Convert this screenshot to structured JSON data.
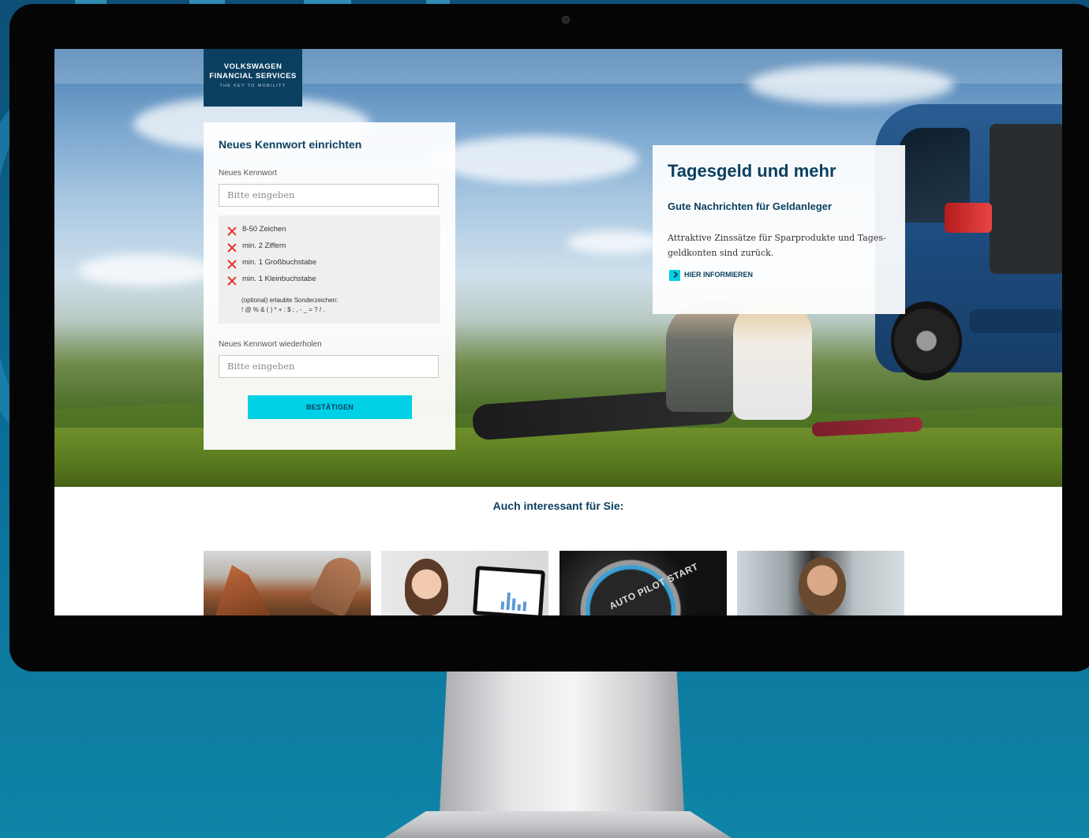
{
  "logo": {
    "line1": "VOLKSWAGEN",
    "line2": "FINANCIAL SERVICES",
    "tagline": "THE KEY TO MOBILITY"
  },
  "password_form": {
    "title": "Neues Kennwort einrichten",
    "new_password_label": "Neues Kennwort",
    "new_password_placeholder": "Bitte eingeben",
    "rules": [
      "8-50 Zeichen",
      "min. 2 Ziffern",
      "min. 1 Großbuchstabe",
      "min. 1 Kleinbuchstabe"
    ],
    "special_chars_note": "(optional) erlaubte Sonderzeichen:",
    "special_chars": "! @ % & ( ) * + : $ ; , - _ = ? / .",
    "repeat_password_label": "Neues Kennwort wiederholen",
    "repeat_password_placeholder": "Bitte eingeben",
    "submit_label": "BESTÄTIGEN"
  },
  "promo": {
    "title": "Tagesgeld und mehr",
    "subtitle": "Gute Nachrichten für Geldanleger",
    "text": "Attraktive Zinssätze für Sparprodukte und Tages-geldkonten sind zurück.",
    "link_label": "HIER INFORMIEREN"
  },
  "also_interesting": {
    "heading": "Auch interessant für Sie:"
  },
  "tiles": {
    "tile3_text": "AUTO PILOT START"
  },
  "colors": {
    "brand_dark_blue": "#0b3f5f",
    "accent_cyan": "#00d1e6",
    "error_red": "#e3342f"
  }
}
